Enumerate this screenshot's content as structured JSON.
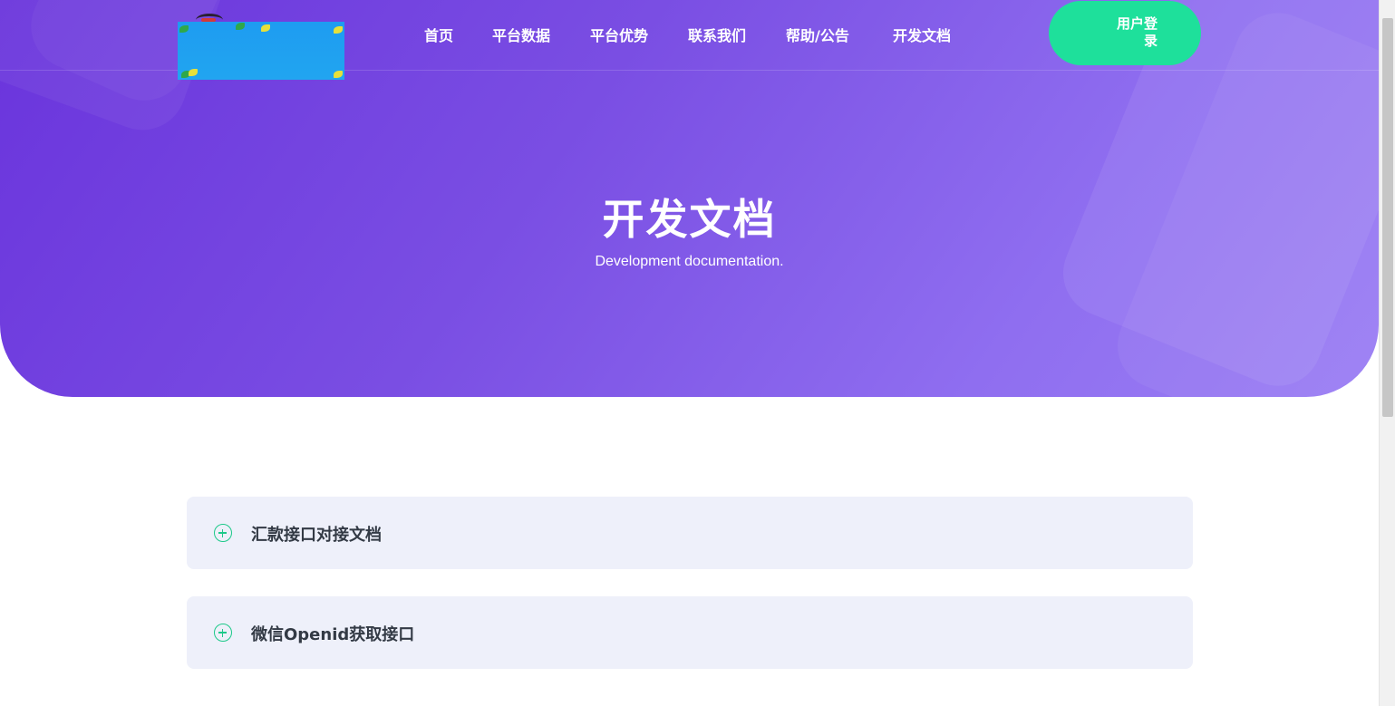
{
  "nav": {
    "items": [
      {
        "label": "首页"
      },
      {
        "label": "平台数据"
      },
      {
        "label": "平台优势"
      },
      {
        "label": "联系我们"
      },
      {
        "label": "帮助/公告"
      },
      {
        "label": "开发文档"
      }
    ],
    "login_label": "用户登录"
  },
  "hero": {
    "title": "开发文档",
    "subtitle": "Development documentation."
  },
  "accordion": {
    "items": [
      {
        "label": "汇款接口对接文档",
        "icon": "plus-circle-icon"
      },
      {
        "label": "微信Openid获取接口",
        "icon": "plus-circle-icon"
      }
    ]
  },
  "colors": {
    "hero_start": "#6a34dc",
    "hero_end": "#9a7ef4",
    "accent_green": "#1ee09b",
    "card_bg": "#eef0fa",
    "text_dark": "#333a45"
  }
}
